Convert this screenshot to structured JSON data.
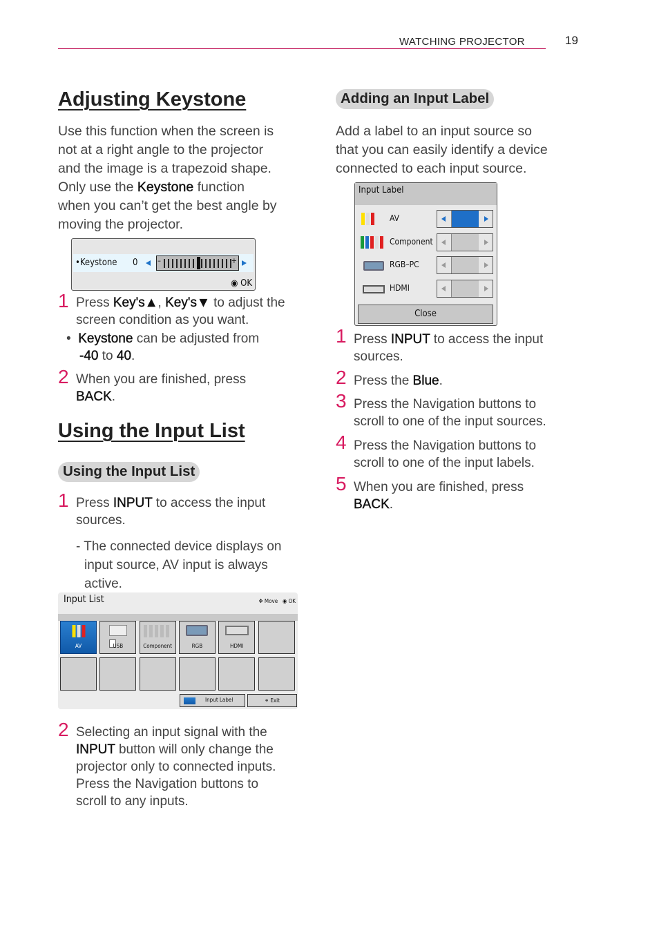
{
  "header": {
    "section": "WATCHING PROJECTOR",
    "page_number": "19",
    "accent_color": "#c2185b"
  },
  "keystone": {
    "title": "Adjusting Keystone",
    "intro_lines": [
      "Use this function when the screen is",
      "not at a right angle to the projector",
      "and the image is a trapezoid shape."
    ],
    "intro_line4_pre": "Only use the ",
    "intro_line4_bold": "Keystone",
    "intro_line4_post": " function",
    "intro_lines_end": [
      "when you can’t get the best angle by",
      "moving the projector."
    ],
    "osd": {
      "label": "•Keystone",
      "value": "0",
      "minus": "–",
      "plus": "+",
      "ok_label": "OK",
      "level": 0.5
    },
    "step1": {
      "num": "1",
      "pre": "Press ",
      "k1": "Key's▲",
      "sep": ", ",
      "k2": "Key's▼",
      "post": " to adjust the",
      "line2": "screen condition as you want."
    },
    "bullet": {
      "dot": "•",
      "bold": "Keystone",
      "text": " can be adjusted from",
      "min": "-40",
      "to": " to ",
      "max": "40",
      "end": "."
    },
    "step2": {
      "num": "2",
      "text": "When you are finished, press",
      "bold": "BACK",
      "end": "."
    }
  },
  "input_list": {
    "title": "Using the Input List",
    "pill": "Using the Input List",
    "step1": {
      "num": "1",
      "pre": "Press ",
      "bold": "INPUT",
      "post": " to access the input",
      "line2": "sources."
    },
    "note_lines": [
      "- The connected device displays on",
      "input source, AV input is always",
      "active."
    ],
    "osd": {
      "title": "Input List",
      "move_label": "Move",
      "ok_label": "OK",
      "cells": [
        "AV",
        "USB",
        "Component",
        "RGB",
        "HDMI",
        "",
        "",
        "",
        "",
        "",
        "",
        ""
      ],
      "selected": "AV",
      "input_label_button": "Input Label",
      "exit_button": "Exit"
    },
    "step2": {
      "num": "2",
      "line1": "Selecting an input signal with the",
      "bold": "INPUT",
      "line2_post": " button will only change the",
      "line3": "projector only to connected inputs.",
      "line4": "Press the Navigation buttons to",
      "line5": "scroll to any inputs."
    }
  },
  "input_label": {
    "pill": "Adding an Input Label",
    "intro_lines": [
      "Add a label to an input source so",
      "that you can easily identify a device",
      "connected to each input source."
    ],
    "dialog": {
      "title": "Input Label",
      "rows": [
        {
          "name": "AV",
          "active": true
        },
        {
          "name": "Component",
          "active": false
        },
        {
          "name": "RGB–PC",
          "active": false
        },
        {
          "name": "HDMI",
          "active": false
        }
      ],
      "close_label": "Close",
      "highlight_color": "#1e6fc8"
    },
    "steps": [
      {
        "num": "1",
        "pre": "Press ",
        "bold": "INPUT",
        "post": " to access the input",
        "line2": "sources."
      },
      {
        "num": "2",
        "pre": "Press the ",
        "bold": "Blue",
        "post": "."
      },
      {
        "num": "3",
        "line1": "Press the Navigation buttons to",
        "line2": "scroll to one of the input sources."
      },
      {
        "num": "4",
        "line1": "Press the Navigation buttons to",
        "line2": "scroll to one of the input labels."
      },
      {
        "num": "5",
        "line1": "When you are finished, press",
        "bold": "BACK",
        "end": "."
      }
    ]
  }
}
